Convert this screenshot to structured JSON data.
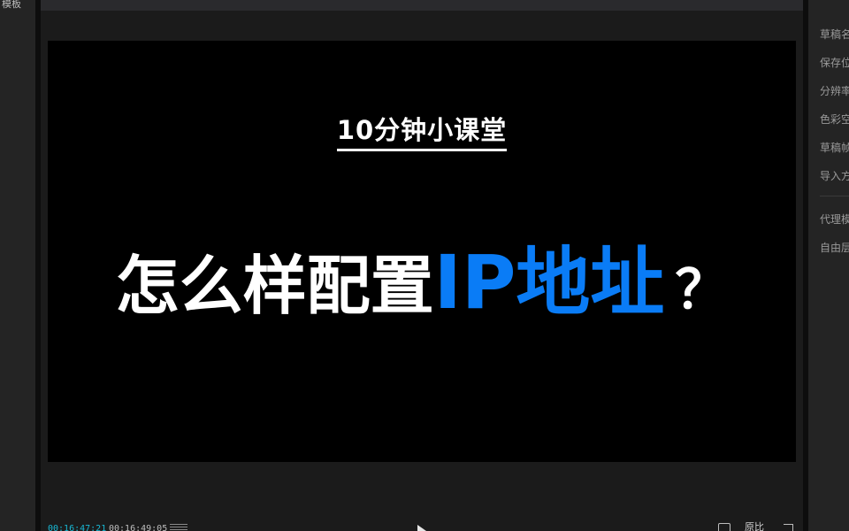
{
  "left_panel": {
    "tab_label": "模板"
  },
  "player": {
    "video": {
      "subtitle": "10分钟小课堂",
      "headline_white": "怎么样配置",
      "headline_blue": "IP地址",
      "headline_question": "？",
      "accent_color": "#0a7cf6"
    },
    "controls": {
      "current_time": "00:16:47:21",
      "total_time": "00:16:49:05",
      "ratio_label": "原比",
      "icons": [
        "list-icon",
        "play-icon",
        "fit-icon",
        "fullscreen-icon"
      ]
    }
  },
  "right_panel": {
    "items": [
      "草稿名称",
      "保存位置",
      "分辨率",
      "色彩空间",
      "草稿帧率",
      "导入方式",
      "代理模式",
      "自由层级"
    ]
  }
}
